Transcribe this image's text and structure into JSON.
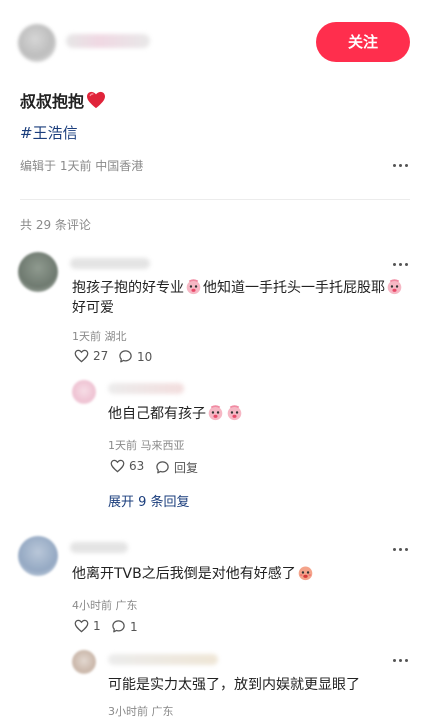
{
  "header": {
    "follow_label": "关注"
  },
  "post": {
    "title": "叔叔抱抱",
    "tag": "#王浩信",
    "meta": "编辑于 1天前 中国香港"
  },
  "comments_total": "共 29 条评论",
  "comments": [
    {
      "text_1": "抱孩子抱的好专业",
      "text_2": "他知道一手托头一手托屁股耶",
      "text_3": "好可爱",
      "meta": "1天前 湖北",
      "likes": "27",
      "replies": "10",
      "sub": {
        "text": "他自己都有孩子",
        "meta": "1天前 马来西亚",
        "likes": "63",
        "reply_label": "回复"
      },
      "expand_label": "展开 9 条回复"
    },
    {
      "text": "他离开TVB之后我倒是对他有好感了",
      "meta": "4小时前 广东",
      "likes": "1",
      "replies": "1",
      "sub": {
        "text": "可能是实力太强了，放到内娱就更显眼了",
        "meta": "3小时前 广东"
      }
    }
  ],
  "colors": {
    "accent": "#ff2e4d",
    "link": "#1a3d7c",
    "meta": "#8a8a8a"
  },
  "icons": [
    "more-icon",
    "heart-icon",
    "like-icon",
    "comment-icon",
    "emoji-icon"
  ]
}
